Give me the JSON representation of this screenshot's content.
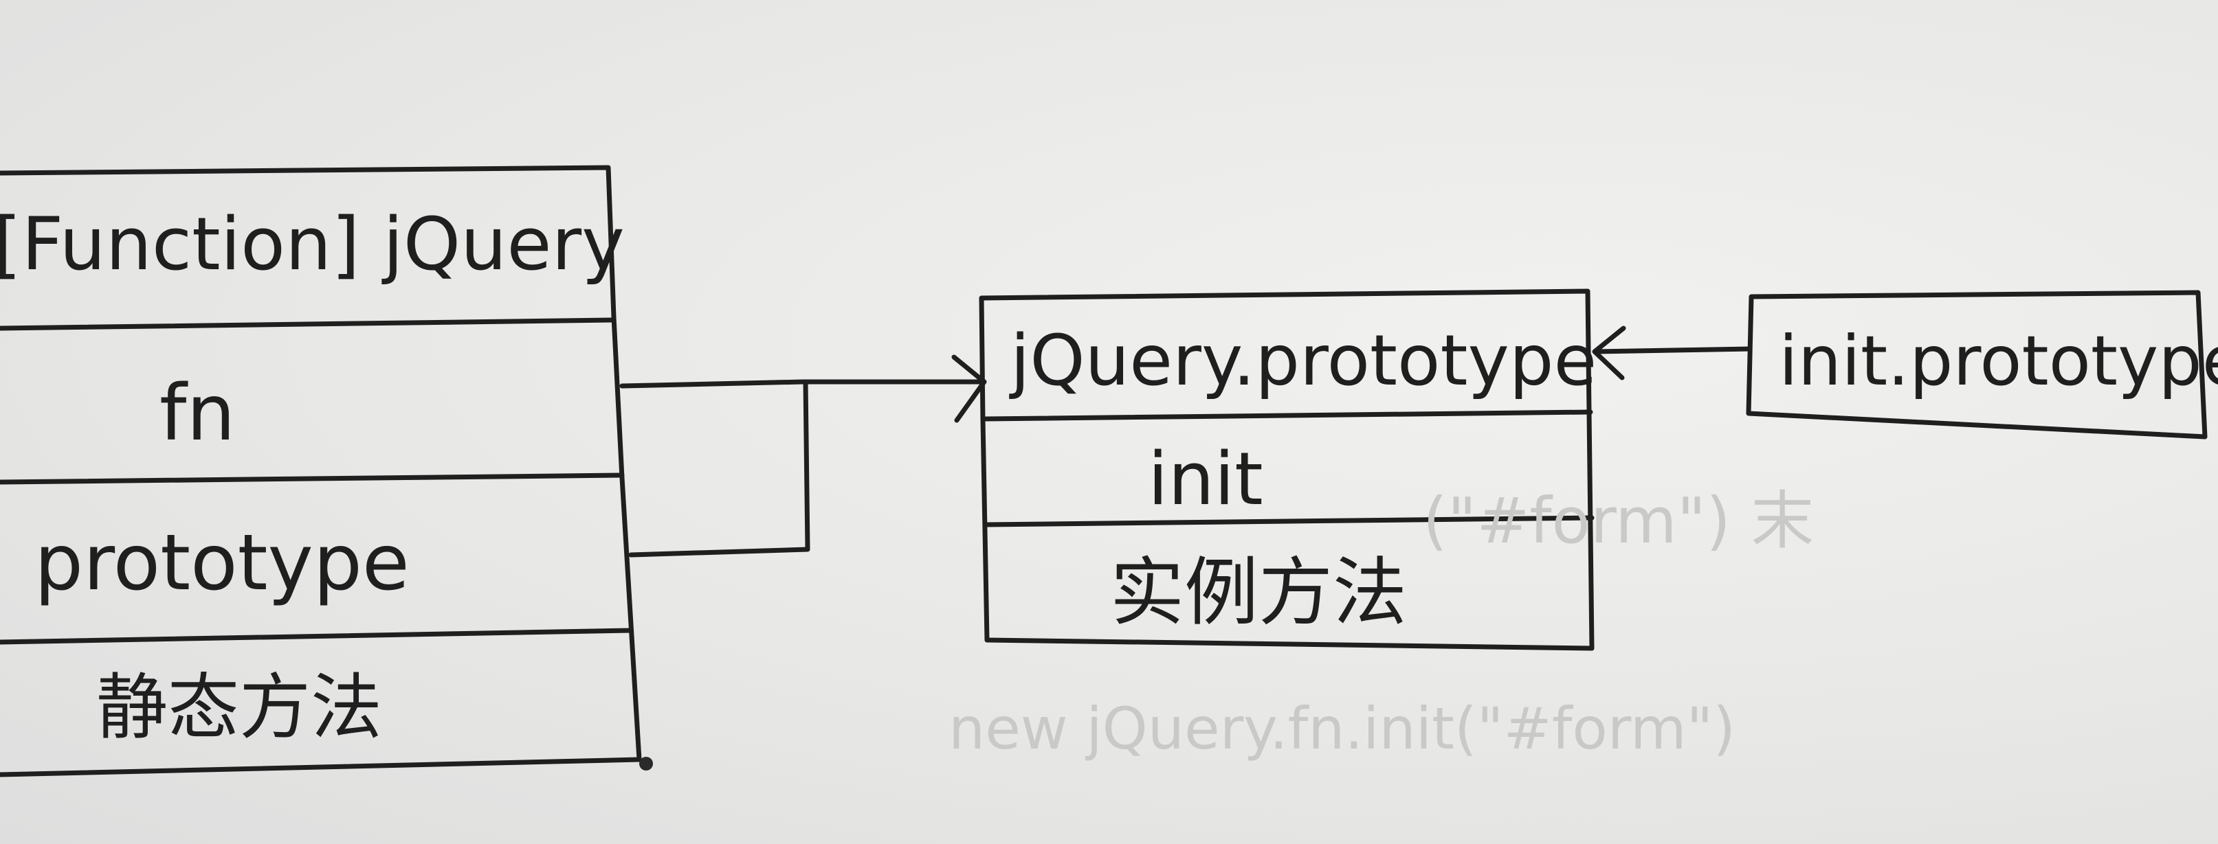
{
  "diagram": {
    "jquery_box": {
      "title": "[Function] jQuery",
      "rows": [
        "fn",
        "prototype",
        "静态方法"
      ]
    },
    "prototype_box": {
      "title": "jQuery.prototype",
      "rows": [
        "init",
        "实例方法"
      ]
    },
    "init_box": {
      "title": "init.prototype"
    },
    "faint_notes": {
      "note_1": "(\"#form\") 末",
      "note_2": "new jQuery.fn.init(\"#form\")"
    },
    "colors": {
      "ink": "#1f1f1f",
      "paper": "#ecebe9",
      "faint_ink": "#c9c9c7"
    }
  }
}
